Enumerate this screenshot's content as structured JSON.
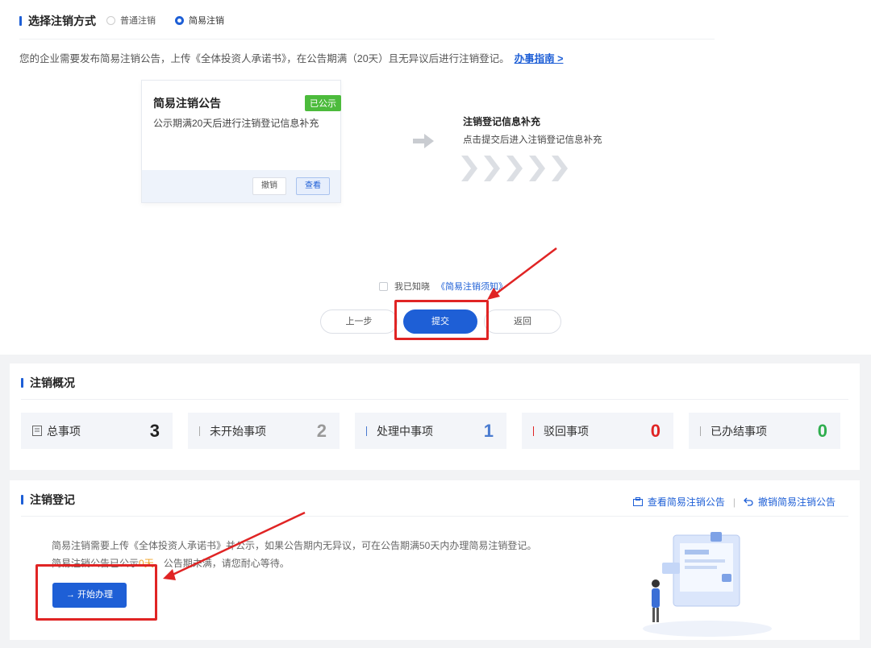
{
  "method": {
    "title": "选择注销方式",
    "options": [
      "普通注销",
      "简易注销"
    ],
    "selected_index": 1,
    "desc": "您的企业需要发布简易注销公告，上传《全体投资人承诺书》，在公告期满（20天）且无异议后进行注销登记。",
    "guide_link": "办事指南 >"
  },
  "card": {
    "title": "简易注销公告",
    "badge": "已公示",
    "sub": "公示期满20天后进行注销登记信息补充",
    "cancel": "撤销",
    "view": "查看"
  },
  "step2": {
    "title": "注销登记信息补充",
    "sub": "点击提交后进入注销登记信息补充"
  },
  "agree": {
    "text": "我已知晓",
    "link": "《简易注销须知》"
  },
  "buttons": {
    "prev": "上一步",
    "submit": "提交",
    "back": "返回"
  },
  "overview": {
    "title": "注销概况",
    "stats": [
      {
        "label": "总事项",
        "value": "3",
        "color": "#222222"
      },
      {
        "label": "未开始事项",
        "value": "2",
        "color": "#999999"
      },
      {
        "label": "处理中事项",
        "value": "1",
        "color": "#4a7bd0"
      },
      {
        "label": "驳回事项",
        "value": "0",
        "color": "#e02424"
      },
      {
        "label": "已办结事项",
        "value": "0",
        "color": "#2fae4e"
      }
    ]
  },
  "registration": {
    "title": "注销登记",
    "link_view": "查看简易注销公告",
    "link_revoke": "撤销简易注销公告",
    "line1": "简易注销需要上传《全体投资人承诺书》并公示，如果公告期内无异议，可在公告期满50天内办理简易注销登记。",
    "line2_a": "简易注销公告已公示",
    "line2_b": "0天",
    "line2_c": "，公告期未满，请您耐心等待。",
    "start": "→  开始办理"
  },
  "colors": {
    "accent": "#1e5fd6",
    "highlight": "#e02424",
    "badge": "#4cbb3c"
  }
}
